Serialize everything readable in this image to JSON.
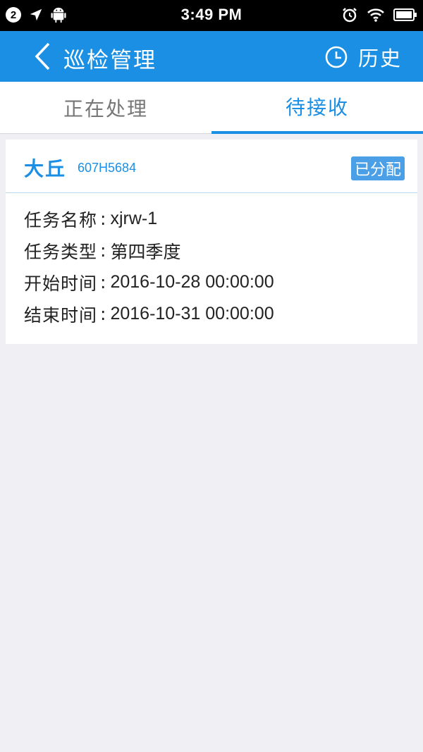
{
  "status_bar": {
    "notification_count": "2",
    "time": "3:49 PM"
  },
  "app_bar": {
    "title": "巡检管理",
    "history_label": "历史"
  },
  "tabs": [
    {
      "label": "正在处理",
      "active": false
    },
    {
      "label": "待接收",
      "active": true
    }
  ],
  "task_card": {
    "name": "大丘",
    "code": "607H5684",
    "status": "已分配",
    "fields": [
      {
        "label": "任务名称",
        "separator": ":",
        "value": "xjrw-1"
      },
      {
        "label": "任务类型",
        "separator": ":",
        "value": "第四季度"
      },
      {
        "label": "开始时间",
        "separator": ":",
        "value": "2016-10-28 00:00:00"
      },
      {
        "label": "结束时间",
        "separator": ":",
        "value": "2016-10-31 00:00:00"
      }
    ]
  },
  "icons": {
    "status_left": [
      "notification-badge",
      "location-arrow-icon",
      "android-icon"
    ],
    "status_right": [
      "alarm-clock-icon",
      "wifi-icon",
      "battery-icon"
    ],
    "app_bar": [
      "back-chevron-icon",
      "clock-icon"
    ]
  },
  "colors": {
    "primary": "#1a8fe3",
    "badge": "#4a9fe6",
    "background": "#efeff4",
    "status_bar": "#000000"
  }
}
